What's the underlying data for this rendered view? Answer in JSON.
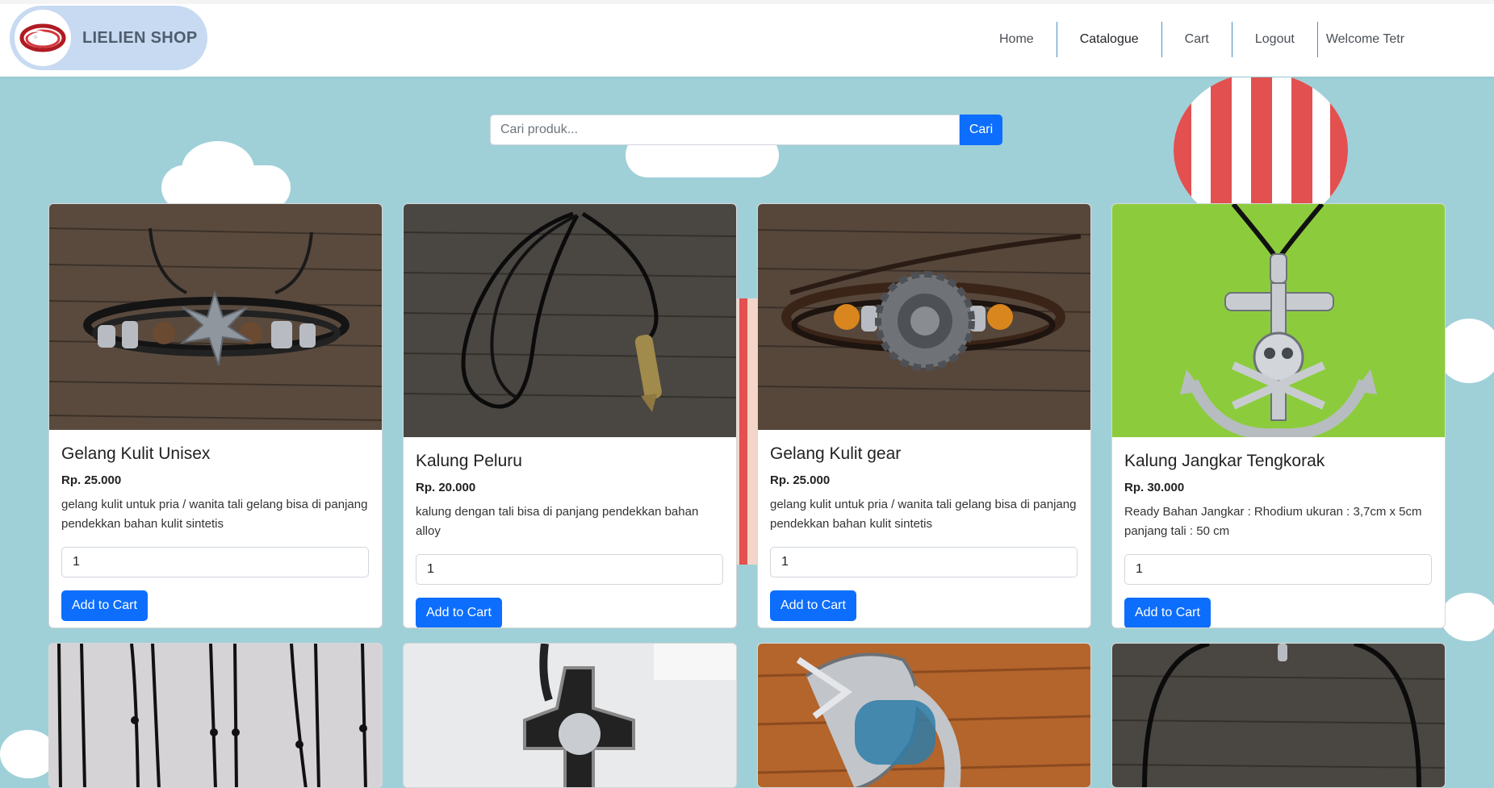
{
  "brand": {
    "name": "LIELIEN SHOP"
  },
  "nav": {
    "items": [
      {
        "label": "Home"
      },
      {
        "label": "Catalogue"
      },
      {
        "label": "Cart"
      },
      {
        "label": "Logout"
      }
    ],
    "welcome": "Welcome Tetr",
    "active": "Catalogue"
  },
  "search": {
    "placeholder": "Cari produk...",
    "button_label": "Cari"
  },
  "colors": {
    "accent": "#0d6efd",
    "background": "#9fd0d8",
    "brand_pill": "#c7daf2"
  },
  "products": [
    {
      "title": "Gelang Kulit Unisex",
      "price": "Rp. 25.000",
      "description": "gelang kulit untuk pria / wanita tali gelang bisa di panjang pendekkan bahan kulit sintetis",
      "quantity": "1",
      "button_label": "Add to Cart"
    },
    {
      "title": "Kalung Peluru",
      "price": "Rp. 20.000",
      "description": "kalung dengan tali bisa di panjang pendekkan bahan alloy",
      "quantity": "1",
      "button_label": "Add to Cart"
    },
    {
      "title": "Gelang Kulit gear",
      "price": "Rp. 25.000",
      "description": "gelang kulit untuk pria / wanita tali gelang bisa di panjang pendekkan bahan kulit sintetis",
      "quantity": "1",
      "button_label": "Add to Cart"
    },
    {
      "title": "Kalung Jangkar Tengkorak",
      "price": "Rp. 30.000",
      "description": "Ready Bahan Jangkar : Rhodium ukuran : 3,7cm x 5cm panjang tali : 50 cm",
      "quantity": "1",
      "button_label": "Add to Cart"
    }
  ]
}
